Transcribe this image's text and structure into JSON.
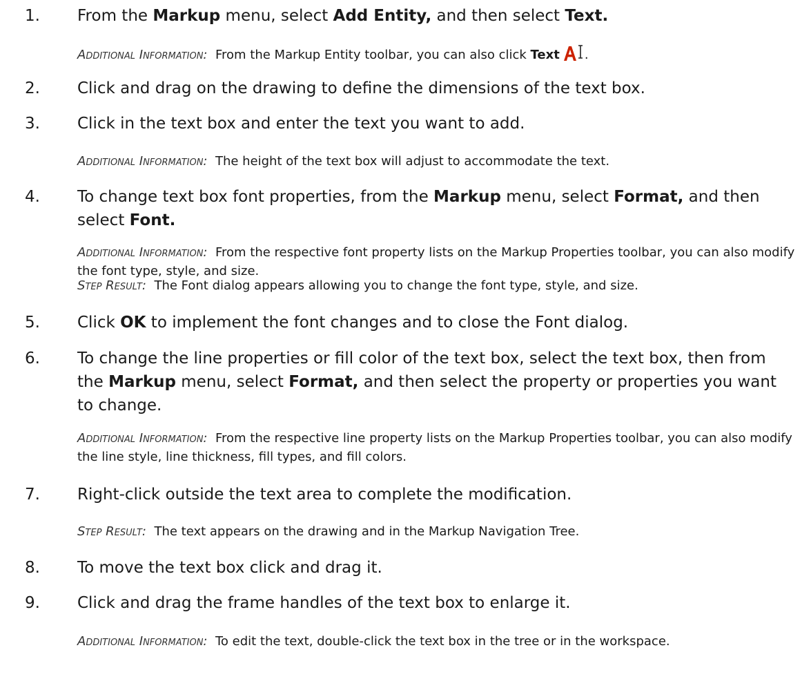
{
  "steps": [
    {
      "num": "1.",
      "main": [
        {
          "t": "From the "
        },
        {
          "t": "Markup",
          "b": true
        },
        {
          "t": " menu, select "
        },
        {
          "t": "Add Entity,",
          "b": true
        },
        {
          "t": " and then select "
        },
        {
          "t": "Text.",
          "b": true
        }
      ],
      "notes": [
        {
          "label": "Additional Information:",
          "parts": [
            {
              "t": "From the Markup Entity toolbar, you can also click "
            },
            {
              "t": "Text",
              "b": true
            },
            {
              "icon": "text-tool-icon"
            },
            {
              "t": "."
            }
          ]
        }
      ]
    },
    {
      "num": "2.",
      "main": [
        {
          "t": "Click and drag on the drawing to define the dimensions of the text box."
        }
      ],
      "notes": []
    },
    {
      "num": "3.",
      "main": [
        {
          "t": "Click in the text box and enter the text you want to add."
        }
      ],
      "notes": [
        {
          "label": "Additional Information:",
          "parts": [
            {
              "t": "The height of the text box will adjust to accommodate the text."
            }
          ]
        }
      ]
    },
    {
      "num": "4.",
      "main": [
        {
          "t": "To change text box font properties, from the "
        },
        {
          "t": "Markup",
          "b": true
        },
        {
          "t": " menu, select "
        },
        {
          "t": "Format,",
          "b": true
        },
        {
          "t": " and then select "
        },
        {
          "t": "Font.",
          "b": true
        }
      ],
      "notes": [
        {
          "label": "Additional Information:",
          "parts": [
            {
              "t": "From the respective font property lists on the Markup Properties toolbar, you can also modify the font type, style, and size."
            }
          ]
        },
        {
          "label": "Step Result:",
          "parts": [
            {
              "t": "The Font dialog appears allowing you to change the font type, style, and size."
            }
          ]
        }
      ]
    },
    {
      "num": "5.",
      "main": [
        {
          "t": "Click "
        },
        {
          "t": "OK",
          "b": true
        },
        {
          "t": " to implement the font changes and to close the Font dialog."
        }
      ],
      "notes": []
    },
    {
      "num": "6.",
      "main": [
        {
          "t": "To change the line properties or fill color of the text box, select the text box, then from the "
        },
        {
          "t": "Markup",
          "b": true
        },
        {
          "t": " menu, select "
        },
        {
          "t": "Format,",
          "b": true
        },
        {
          "t": " and then select the property or properties you want to change."
        }
      ],
      "notes": [
        {
          "label": "Additional Information:",
          "parts": [
            {
              "t": "From the respective line property lists on the Markup Properties toolbar, you can also modify the line style, line thickness, fill types, and fill colors."
            }
          ]
        }
      ]
    },
    {
      "num": "7.",
      "main": [
        {
          "t": "Right-click outside the text area to complete the modification."
        }
      ],
      "notes": [
        {
          "label": "Step Result:",
          "parts": [
            {
              "t": "The text appears on the drawing and in the Markup Navigation Tree."
            }
          ]
        }
      ]
    },
    {
      "num": "8.",
      "main": [
        {
          "t": "To move the text box click and drag it."
        }
      ],
      "notes": []
    },
    {
      "num": "9.",
      "main": [
        {
          "t": "Click and drag the frame handles of the text box to enlarge it."
        }
      ],
      "notes": [
        {
          "label": "Additional Information:",
          "parts": [
            {
              "t": "To edit the text, double-click the text box in the tree or in the workspace."
            }
          ]
        }
      ]
    }
  ],
  "colors": {
    "text": "#1a1a1a",
    "icon_red": "#cc2200"
  }
}
